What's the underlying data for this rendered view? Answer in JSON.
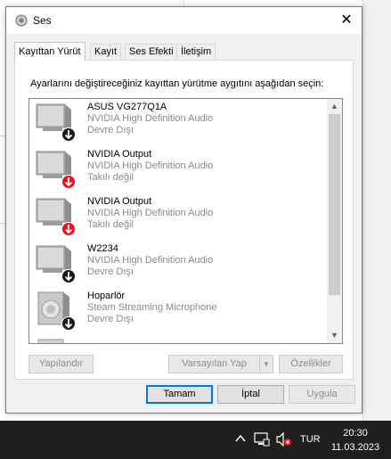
{
  "dialog": {
    "title": "Ses",
    "close_glyph": "✕"
  },
  "tabs": [
    {
      "label": "Kayıttan Yürüt",
      "active": true
    },
    {
      "label": "Kayıt",
      "active": false
    },
    {
      "label": "Ses Efekti",
      "active": false
    },
    {
      "label": "İletişim",
      "active": false
    }
  ],
  "playback": {
    "instruction": "Ayarlarını değiştireceğiniz kayıttan yürütme aygıtını aşağıdan seçin:",
    "devices": [
      {
        "name": "ASUS VG277Q1A",
        "description": "NVIDIA High Definition Audio",
        "status": "Devre Dışı",
        "icon": "monitor-icon",
        "badge": "disabled-badge-icon"
      },
      {
        "name": "NVIDIA Output",
        "description": "NVIDIA High Definition Audio",
        "status": "Takılı değil",
        "icon": "monitor-icon",
        "badge": "unplugged-badge-icon"
      },
      {
        "name": "NVIDIA Output",
        "description": "NVIDIA High Definition Audio",
        "status": "Takılı değil",
        "icon": "monitor-icon",
        "badge": "unplugged-badge-icon"
      },
      {
        "name": "W2234",
        "description": "NVIDIA High Definition Audio",
        "status": "Devre Dışı",
        "icon": "monitor-icon",
        "badge": "disabled-badge-icon"
      },
      {
        "name": "Hoparlör",
        "description": "Steam Streaming Microphone",
        "status": "Devre Dışı",
        "icon": "speaker-icon",
        "badge": "disabled-badge-icon"
      }
    ],
    "configure_label": "Yapılandır",
    "set_default_label": "Varsayılan Yap",
    "properties_label": "Özellikler"
  },
  "buttons": {
    "ok": "Tamam",
    "cancel": "İptal",
    "apply": "Uygula"
  },
  "taskbar": {
    "language": "TUR",
    "time": "20:30",
    "date": "11.03.2023"
  },
  "colors": {
    "disabled_badge": "#1a1a1a",
    "unplugged_badge": "#e81123",
    "default_button_border": "#0078d7",
    "taskbar": "#201f1e"
  }
}
